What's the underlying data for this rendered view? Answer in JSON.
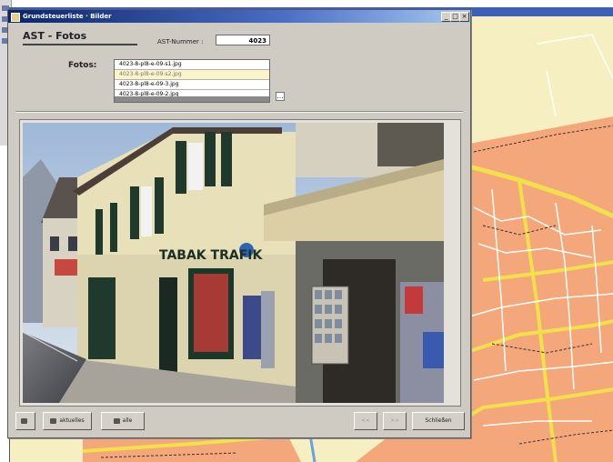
{
  "window": {
    "title": "Grundsteuerliste · Bilder",
    "min_label": "_",
    "max_label": "□",
    "close_label": "×"
  },
  "form": {
    "title": "AST - Fotos",
    "ast_label": "AST-Nummer :",
    "ast_value": "4023",
    "fotos_label": "Fotos:",
    "photos": [
      "4023-8-pl8-e-09-s1.jpg",
      "4023-8-pl8-e-09-s2.jpg",
      "4023-8-pl8-e-09-3.jpg",
      "4023-8-pl8-e-09-2.jpg"
    ],
    "selected_index": 1,
    "browse_label": "…"
  },
  "photo": {
    "shop_sign": "TABAK TRAFIK"
  },
  "buttons": {
    "aktuelles": "aktuelles",
    "alle": "alle",
    "prev": "<<",
    "next": ">>",
    "schliessen": "Schließen"
  },
  "icons": {
    "app": "app-icon",
    "print": "printer-icon",
    "toolbar": "toolbar-icon"
  },
  "colors": {
    "title_bar": "#0a246a",
    "map_land": "#f6efc2",
    "map_parcel": "#f4a77a",
    "map_road": "#f0e14a"
  }
}
